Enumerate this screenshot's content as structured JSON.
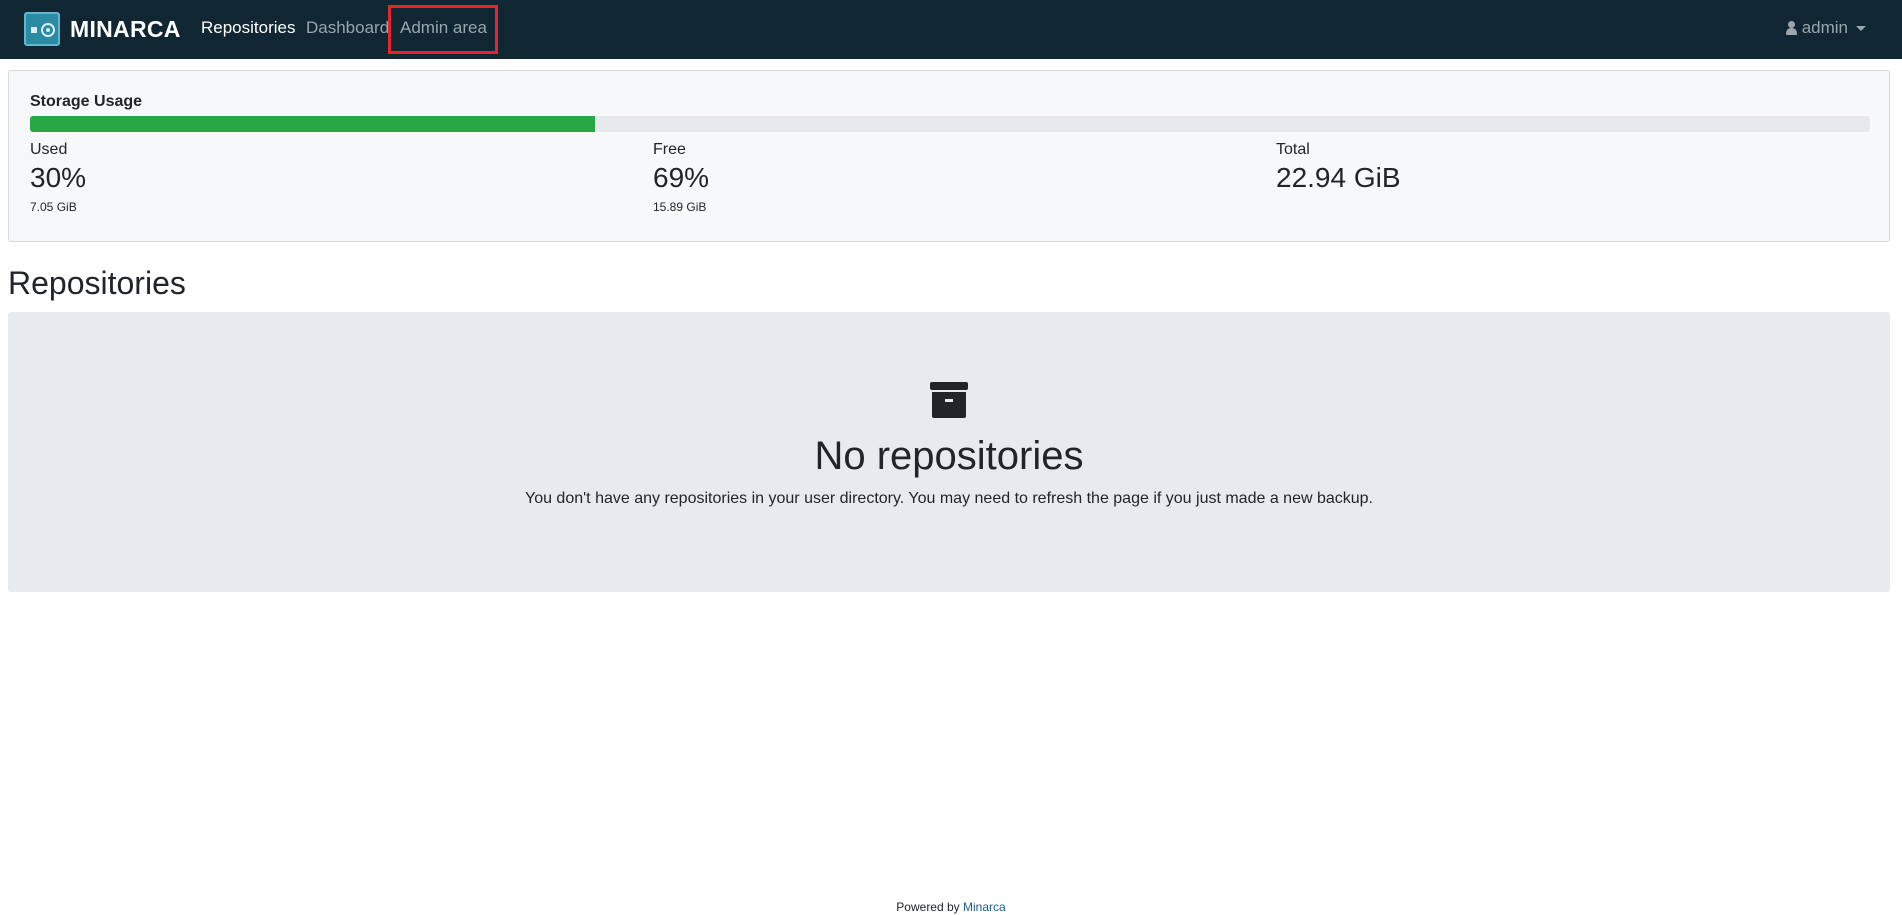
{
  "navbar": {
    "brand": "MINARCA",
    "links": [
      {
        "label": "Repositories",
        "active": true
      },
      {
        "label": "Dashboard",
        "active": false
      },
      {
        "label": "Admin area",
        "active": false
      }
    ],
    "user": "admin",
    "highlight_color": "#e3262d",
    "background": "#102733"
  },
  "storage": {
    "title": "Storage Usage",
    "used_fraction": 0.307,
    "used": {
      "label": "Used",
      "value": "30%",
      "sub": "7.05 GiB"
    },
    "free": {
      "label": "Free",
      "value": "69%",
      "sub": "15.89 GiB"
    },
    "total": {
      "label": "Total",
      "value": "22.94 GiB"
    },
    "bar_color": "#28a745"
  },
  "repositories": {
    "heading": "Repositories",
    "empty_title": "No repositories",
    "empty_text": "You don't have any repositories in your user directory. You may need to refresh the page if you just made a new backup.",
    "icon": "archive-icon"
  },
  "footer": {
    "prefix": "Powered by",
    "link": "Minarca"
  }
}
